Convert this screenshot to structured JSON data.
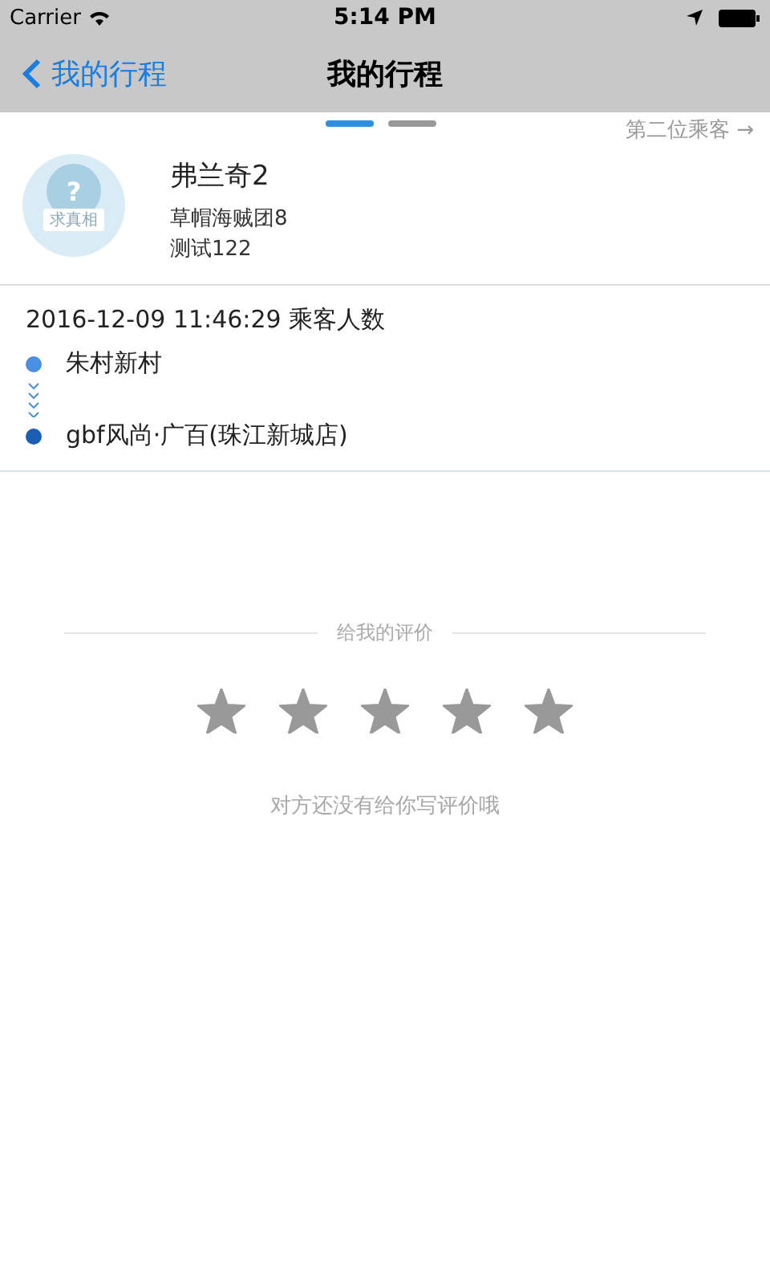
{
  "status_bar": {
    "carrier": "Carrier",
    "time": "5:14 PM"
  },
  "nav_bar": {
    "back_label": "我的行程",
    "title": "我的行程"
  },
  "pager": {
    "pages": [
      {
        "selected": true
      },
      {
        "selected": false
      }
    ],
    "next_label": "第二位乘客 →"
  },
  "passenger": {
    "avatar_mark": "?",
    "avatar_caption": "求真相",
    "name": "弗兰奇2",
    "line_1": "草帽海贼团8",
    "line_2": "测试122"
  },
  "trip": {
    "datetime": "2016-12-09 11:46:29 乘客人数",
    "origin": "朱村新村",
    "destination": "gbf风尚·广百(珠江新城店)"
  },
  "rating": {
    "heading": "给我的评价",
    "stars": 5,
    "note": "对方还没有给你写评价哦"
  }
}
